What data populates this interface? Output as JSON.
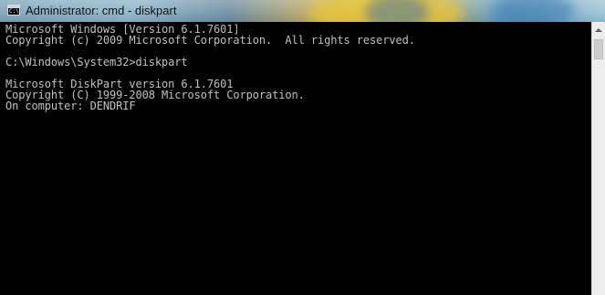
{
  "window": {
    "title": "Administrator: cmd - diskpart",
    "icon_label": "C:\\"
  },
  "console": {
    "lines": [
      "Microsoft Windows [Version 6.1.7601]",
      "Copyright (c) 2009 Microsoft Corporation.  All rights reserved.",
      "",
      "C:\\Windows\\System32>diskpart",
      "",
      "Microsoft DiskPart version 6.1.7601",
      "Copyright (C) 1999-2008 Microsoft Corporation.",
      "On computer: DENDRIF"
    ]
  },
  "colors": {
    "console_background": "#000000",
    "console_text": "#c0c0c0"
  }
}
